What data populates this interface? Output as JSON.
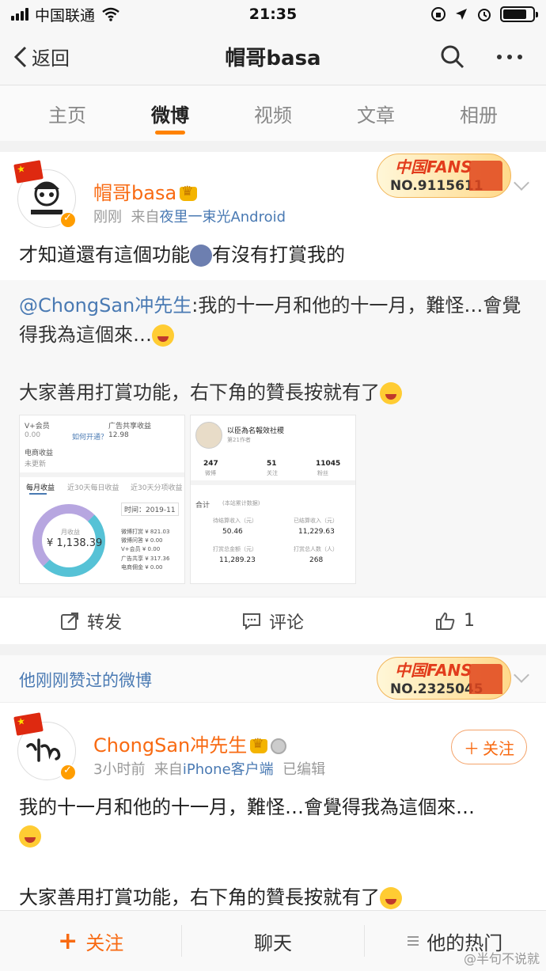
{
  "status_bar": {
    "carrier": "中国联通",
    "time": "21:35"
  },
  "nav": {
    "back_label": "返回",
    "title": "帽哥basa"
  },
  "tabs": [
    {
      "label": "主页",
      "active": false
    },
    {
      "label": "微博",
      "active": true
    },
    {
      "label": "视频",
      "active": false
    },
    {
      "label": "文章",
      "active": false
    },
    {
      "label": "相册",
      "active": false
    }
  ],
  "post1": {
    "username": "帽哥basa",
    "time": "刚刚",
    "source_prefix": "来自",
    "source": "夜里一束光Android",
    "fans_badge": {
      "title": "中国FANS",
      "number": "NO.9115611"
    },
    "text_part1": "才知道還有這個功能",
    "text_part2": "有沒有打賞我的",
    "repost": {
      "mention": "@ChongSan冲先生",
      "text": ":我的十一月和他的十一月，難怪…會覺得我為這個來…",
      "text2": "大家善用打賞功能，右下角的贊長按就有了"
    },
    "image1": {
      "vip_label": "V+会员",
      "vip_value": "0.00",
      "vip_link": "如何开通？",
      "ad_label": "广告共享收益",
      "ad_value": "12.98",
      "ecom_label": "电商收益",
      "ecom_value": "未更新",
      "tab_monthly": "每月收益",
      "tab_30": "近30天每日收益",
      "tab_30b": "近30天分项收益",
      "month": "时间：2019-11",
      "donut_label": "月收益",
      "amount": "¥ 1,138.39",
      "legend": [
        "微博打赏 ¥ 821.03",
        "微博问答 ¥ 0.00",
        "V+会员 ¥ 0.00",
        "广告共享 ¥ 317.36",
        "电商佣金 ¥ 0.00"
      ]
    },
    "image2": {
      "name": "以臣為名報效社稷",
      "sub": "第21作者",
      "stat1_value": "247",
      "stat1_label": "微博",
      "stat2_value": "51",
      "stat2_label": "关注",
      "stat3_value": "11045",
      "stat3_label": "粉丝",
      "total_label": "合计",
      "note": "(本站累计数据)",
      "cell1_label": "待结算收入（元）",
      "cell1_value": "50.46",
      "cell2_label": "已结算收入（元）",
      "cell2_value": "11,229.63",
      "cell3_label": "打赏总金额（元）",
      "cell3_value": "11,289.23",
      "cell4_label": "打赏总人数（人）",
      "cell4_value": "268"
    },
    "actions": {
      "repost": "转发",
      "comment": "评论",
      "like_count": "1"
    }
  },
  "post2": {
    "header_label": "他刚刚赞过的微博",
    "fans_badge": {
      "title": "中国FANS",
      "number": "NO.2325045"
    },
    "username": "ChongSan冲先生",
    "time": "3小时前",
    "source_prefix": "来自",
    "source": "iPhone客户端",
    "edited": "已编辑",
    "follow_label": "关注",
    "text1": "我的十一月和他的十一月，難怪…會覺得我為這個來…",
    "text2": "大家善用打賞功能，右下角的贊長按就有了"
  },
  "bottom_bar": {
    "follow": "关注",
    "chat": "聊天",
    "hot": "他的热门"
  },
  "watermark": "@半句不说就",
  "colors": {
    "accent": "#ff8200",
    "link": "#4a7ab3",
    "username": "#f86a12"
  },
  "icons": [
    "signal-icon",
    "wifi-icon",
    "battery-icon",
    "back-chevron-icon",
    "search-icon",
    "more-icon",
    "repost-icon",
    "comment-icon",
    "like-icon",
    "chevron-down-icon",
    "crown-icon",
    "verified-icon",
    "flag-icon",
    "menu-icon"
  ]
}
